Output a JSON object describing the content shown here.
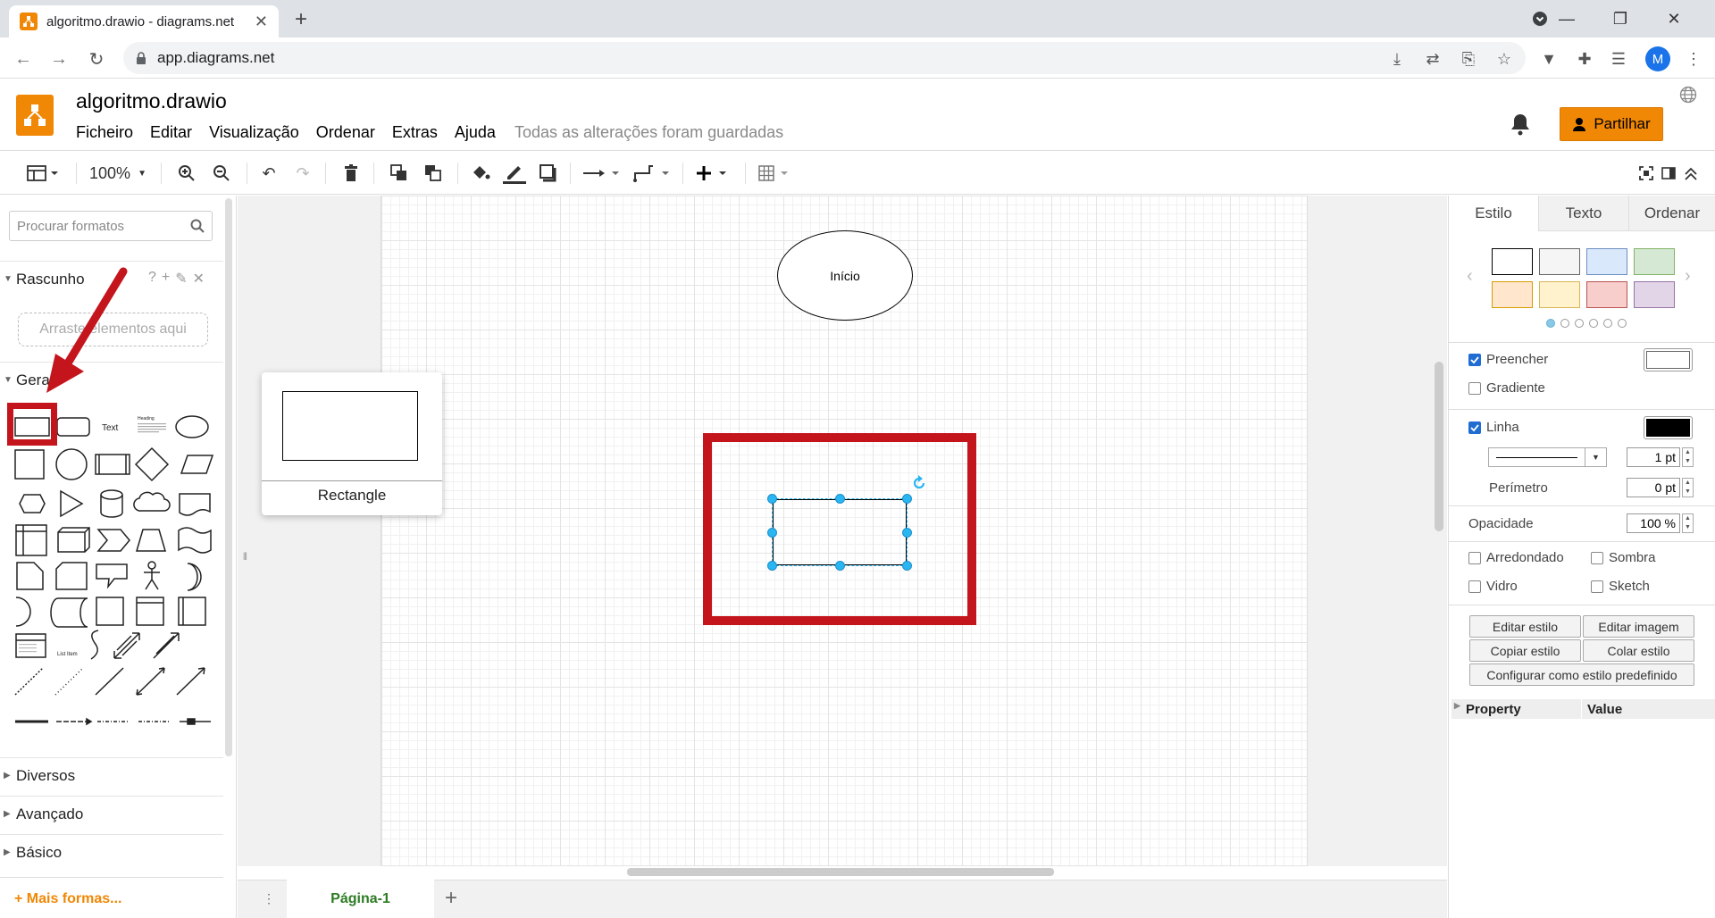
{
  "browser": {
    "tab_title": "algoritmo.drawio - diagrams.net",
    "url": "app.diagrams.net",
    "profile_initial": "M"
  },
  "app": {
    "doc_title": "algoritmo.drawio",
    "menus": [
      "Ficheiro",
      "Editar",
      "Visualização",
      "Ordenar",
      "Extras",
      "Ajuda"
    ],
    "status": "Todas as alterações foram guardadas",
    "share_label": "Partilhar"
  },
  "toolbar": {
    "zoom": "100%"
  },
  "sidebar": {
    "search_placeholder": "Procurar formatos",
    "scratch_title": "Rascunho",
    "scratch_drop": "Arraste elementos aqui",
    "general_title": "Geral",
    "shape_text_label": "Text",
    "shape_heading_label": "Heading",
    "shape_listitem_label": "List Item",
    "sections": [
      "Diversos",
      "Avançado",
      "Básico"
    ],
    "more_shapes": "+ Mais formas..."
  },
  "canvas": {
    "start_label": "Início",
    "tooltip_label": "Rectangle"
  },
  "pages": {
    "active_page": "Página-1"
  },
  "format_panel": {
    "tabs": [
      "Estilo",
      "Texto",
      "Ordenar"
    ],
    "fill_label": "Preencher",
    "gradient_label": "Gradiente",
    "line_label": "Linha",
    "line_width": "1 pt",
    "perimeter_label": "Perímetro",
    "perimeter_value": "0 pt",
    "opacity_label": "Opacidade",
    "opacity_value": "100 %",
    "rounded_label": "Arredondado",
    "shadow_label": "Sombra",
    "glass_label": "Vidro",
    "sketch_label": "Sketch",
    "btn_edit_style": "Editar estilo",
    "btn_edit_image": "Editar imagem",
    "btn_copy_style": "Copiar estilo",
    "btn_paste_style": "Colar estilo",
    "btn_set_default": "Configurar como estilo predefinido",
    "prop_col": "Property",
    "value_col": "Value",
    "swatch_colors": [
      "#ffffff",
      "#f5f5f5",
      "#dae8fc",
      "#d5e8d4",
      "#ffe6cc",
      "#fff2cc",
      "#f8cecc",
      "#e1d5e7"
    ],
    "fill_checked": true,
    "line_checked": true
  },
  "colors": {
    "accent": "#f08705",
    "selection": "#29b6f2",
    "annotation_red": "#c4151c"
  }
}
